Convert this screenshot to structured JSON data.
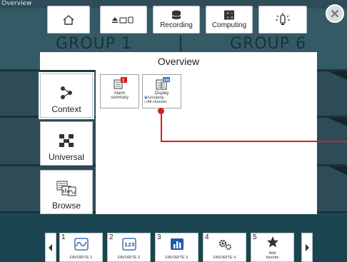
{
  "window_title": "Overview",
  "background": {
    "group_left": "GROUP 1",
    "group_right": "GROUP 6"
  },
  "toolbar": {
    "recording_label": "Recording",
    "computing_label": "Computing"
  },
  "overview_title": "Overview",
  "side_menu": [
    {
      "label": "Context",
      "icon": "context-icon"
    },
    {
      "label": "Universal",
      "icon": "universal-icon"
    },
    {
      "label": "Browse",
      "icon": "browse-icon"
    }
  ],
  "cards": {
    "alarm_summary": "Alarm\nsummary",
    "display": {
      "title": "Display",
      "option1": "Grouping",
      "option2": "All  channel"
    }
  },
  "favorites": [
    {
      "number": "1",
      "label": "FAVORITE 1",
      "icon": "waveform-icon"
    },
    {
      "number": "2",
      "label": "FAVORITE 2",
      "icon": "digital-123-icon"
    },
    {
      "number": "3",
      "label": "FAVORITE 3",
      "icon": "bar-chart-icon"
    },
    {
      "number": "4",
      "label": "FAVORITE 4",
      "icon": "gears-icon"
    },
    {
      "number": "5",
      "label": "Add\nfavorite",
      "icon": "star-icon"
    }
  ],
  "colors": {
    "background": "#2e4c58",
    "accent_red": "#d81e1e",
    "panel": "#ffffff"
  }
}
